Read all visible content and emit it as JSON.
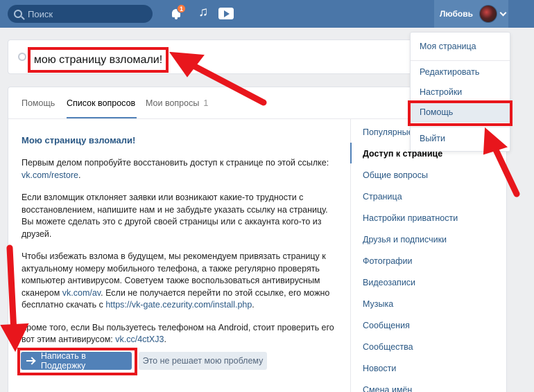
{
  "header": {
    "search_placeholder": "Поиск",
    "notification_count": "1",
    "user_name": "Любовь"
  },
  "question_field": {
    "value": "мою страницу взломали!"
  },
  "tabs": [
    {
      "label": "Помощь"
    },
    {
      "label": "Список вопросов"
    },
    {
      "label": "Мои вопросы",
      "count": "1"
    }
  ],
  "article": {
    "title": "Мою страницу взломали!",
    "p1": "Первым делом попробуйте восстановить доступ к странице по этой ссылке:",
    "p1_link": "vk.com/restore",
    "p1_end": ".",
    "p2": "Если взломщик отклоняет заявки или возникают какие-то трудности с восстановлением, напишите нам и не забудьте указать ссылку на страницу. Вы можете сделать это с другой своей страницы или с аккаунта кого-то из друзей.",
    "p3_a": "Чтобы избежать взлома в будущем, мы рекомендуем привязать страницу к актуальному номеру мобильного телефона, а также регулярно проверять компьютер антивирусом. Советуем также воспользоваться антивирусным сканером",
    "p3_link1": "vk.com/av",
    "p3_b": ". Если не получается перейти по этой ссылке, его можно бесплатно скачать с",
    "p3_link2": "https://vk-gate.cezurity.com/install.php",
    "p3_end": ".",
    "p4": "Кроме того, если Вы пользуетесь телефоном на Android, стоит проверить его вот этим антивирусом:",
    "p4_link": "vk.cc/4ctXJ3",
    "p4_end": "."
  },
  "buttons": {
    "support": "Написать в Поддержку",
    "not_solved": "Это не решает мою проблему"
  },
  "sidebar": {
    "items": [
      "Популярные",
      "Доступ к странице",
      "Общие вопросы",
      "Страница",
      "Настройки приватности",
      "Друзья и подписчики",
      "Фотографии",
      "Видеозаписи",
      "Музыка",
      "Сообщения",
      "Сообщества",
      "Новости",
      "Смена имён"
    ],
    "active_index": 1
  },
  "dropdown": {
    "items": [
      "Моя страница",
      "Редактировать",
      "Настройки",
      "Помощь",
      "Выйти"
    ]
  },
  "colors": {
    "header": "#4a76a8",
    "accent": "#5181b8",
    "link": "#2a5885",
    "annotation_red": "#e8161c"
  }
}
